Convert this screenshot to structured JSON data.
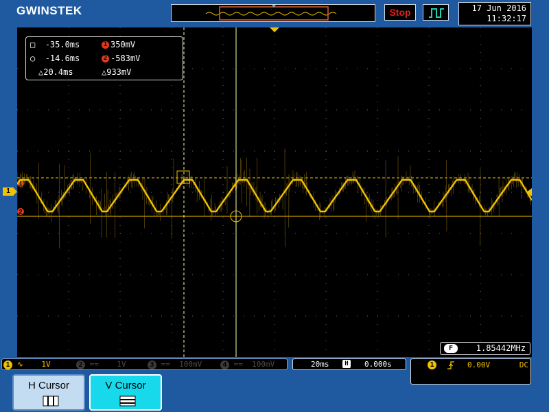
{
  "header": {
    "brand": "GWINSTEK",
    "run_state": "Stop",
    "date": "17 Jun 2016",
    "time": "11:32:17",
    "trigger_icon": "pulse-trigger-icon"
  },
  "cursor_readout": {
    "h1": "-35.0ms",
    "h2": "-14.6ms",
    "h_delta": "20.4ms",
    "v1": "350mV",
    "v2": "-583mV",
    "v_delta": "933mV",
    "cursor1_tag": "1",
    "cursor2_tag": "2"
  },
  "frequency": {
    "badge": "F",
    "value": "1.85442MHz"
  },
  "channel_marker": "1",
  "channels": [
    {
      "num": "1",
      "coupling": "∿",
      "scale": "1V",
      "color": "#f2c200"
    },
    {
      "num": "2",
      "coupling": "==",
      "scale": "1V",
      "color": "#4a4a4a"
    },
    {
      "num": "3",
      "coupling": "==",
      "scale": "100mV",
      "color": "#4a4a4a"
    },
    {
      "num": "4",
      "coupling": "==",
      "scale": "100mV",
      "color": "#4a4a4a"
    }
  ],
  "timebase": {
    "scale": "20ms",
    "position_icon": "H",
    "position": "0.000s"
  },
  "trigger": {
    "source": "1",
    "slope_icon": "rising-edge-icon",
    "level": "0.00V",
    "coupling": "DC"
  },
  "softkeys": [
    {
      "label": "H Cursor",
      "icon": "h-cursor-icon"
    },
    {
      "label": "V Cursor",
      "icon": "v-cursor-icon"
    }
  ],
  "colors": {
    "trace": "#f2c200",
    "background": "#1f5aa0",
    "stop": "#e02020",
    "active_softkey": "#18d8ec"
  }
}
